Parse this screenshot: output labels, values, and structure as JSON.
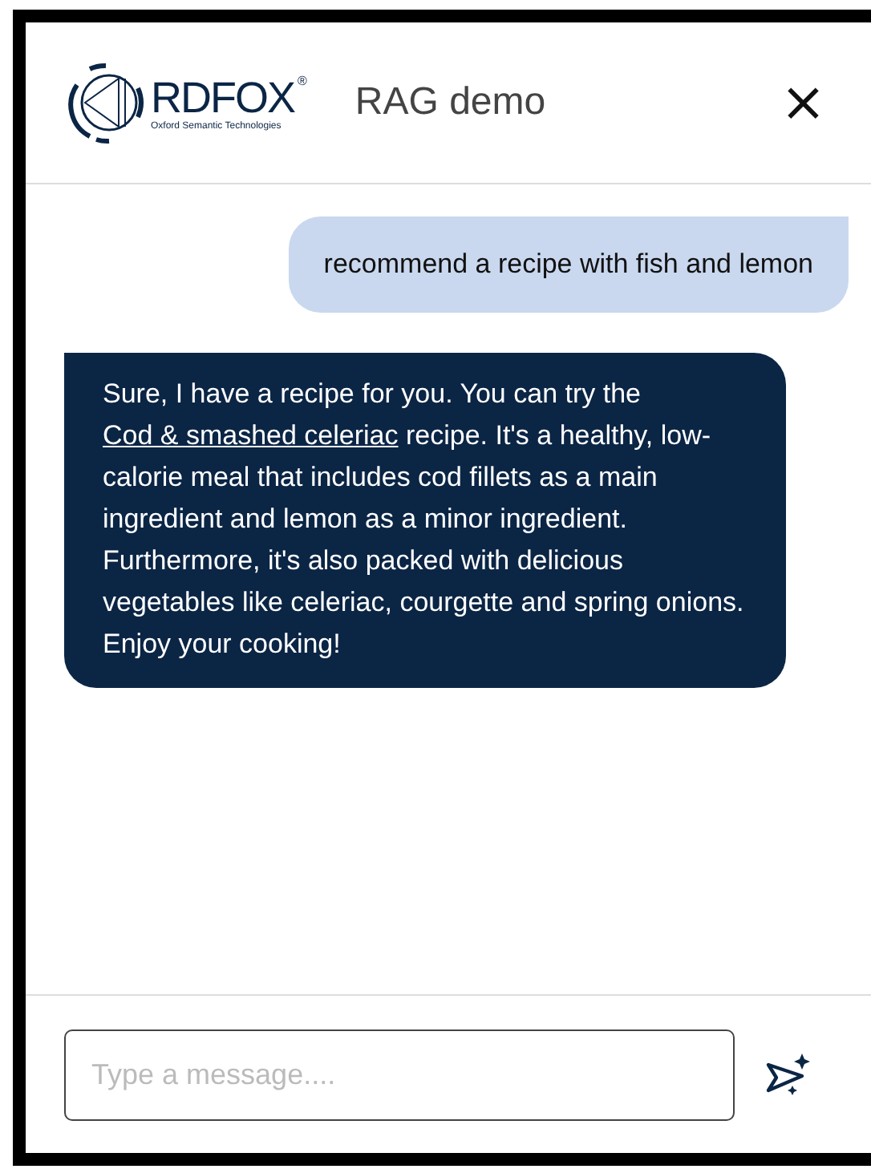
{
  "header": {
    "logo": {
      "name": "RDFOX",
      "mark": "®",
      "tagline": "Oxford Semantic Technologies"
    },
    "title": "RAG demo",
    "close": "×"
  },
  "messages": [
    {
      "kind": "user",
      "text": "recommend a recipe with fish and lemon"
    },
    {
      "kind": "assistant",
      "parts": [
        "Sure, I have a recipe for you. You can try the ",
        {
          "link": "Cod & smashed celeriac"
        },
        " recipe. It's a healthy, low-calorie meal that includes cod fillets as a main ingredient and lemon as a minor ingredient. Furthermore, it's also packed with delicious vegetables like celeriac, courgette and spring onions. Enjoy your cooking!"
      ]
    }
  ],
  "composer": {
    "placeholder": "Type a message...."
  }
}
